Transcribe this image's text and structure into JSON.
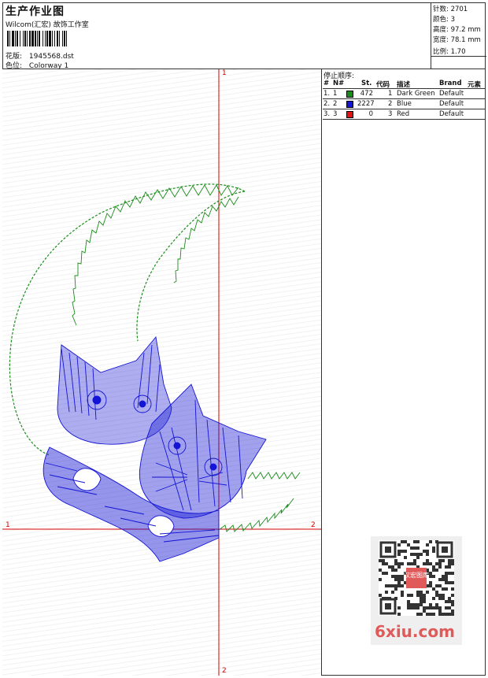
{
  "header": {
    "title": "生产作业图",
    "studio": "Wilcom(汇宏) 故饰工作室",
    "design_label": "花版:",
    "design_value": "1945568.dst",
    "colorway_label": "色位:",
    "colorway_value": "Colorway 1"
  },
  "stats": {
    "stitches": "针数: 2701",
    "colors": "颜色: 3",
    "height": "高度: 97.2 mm",
    "width": "宽度: 78.1 mm",
    "scale": "比例: 1.70"
  },
  "stop_sequence": {
    "title": "停止顺序:",
    "columns": [
      "#",
      "N#",
      "St.",
      "代码",
      "描述",
      "Brand",
      "元素"
    ],
    "rows": [
      {
        "idx": "1.",
        "n": "1",
        "color": "#1a8c1a",
        "st": "472",
        "code": "1",
        "desc": "Dark Green",
        "brand": "Default"
      },
      {
        "idx": "2.",
        "n": "2",
        "color": "#1414d4",
        "st": "2227",
        "code": "2",
        "desc": "Blue",
        "brand": "Default"
      },
      {
        "idx": "3.",
        "n": "3",
        "color": "#e01414",
        "st": "0",
        "code": "3",
        "desc": "Red",
        "brand": "Default"
      }
    ]
  },
  "axis_labels": {
    "top": "1",
    "left": "1",
    "right": "2",
    "bottom": "2"
  },
  "watermark": {
    "qr_text": "汉宏图库",
    "site": "6xiu.com"
  },
  "colors": {
    "green": "#1a8c1a",
    "blue": "#1414d4",
    "red": "#e01414",
    "axis": "#d40000"
  }
}
